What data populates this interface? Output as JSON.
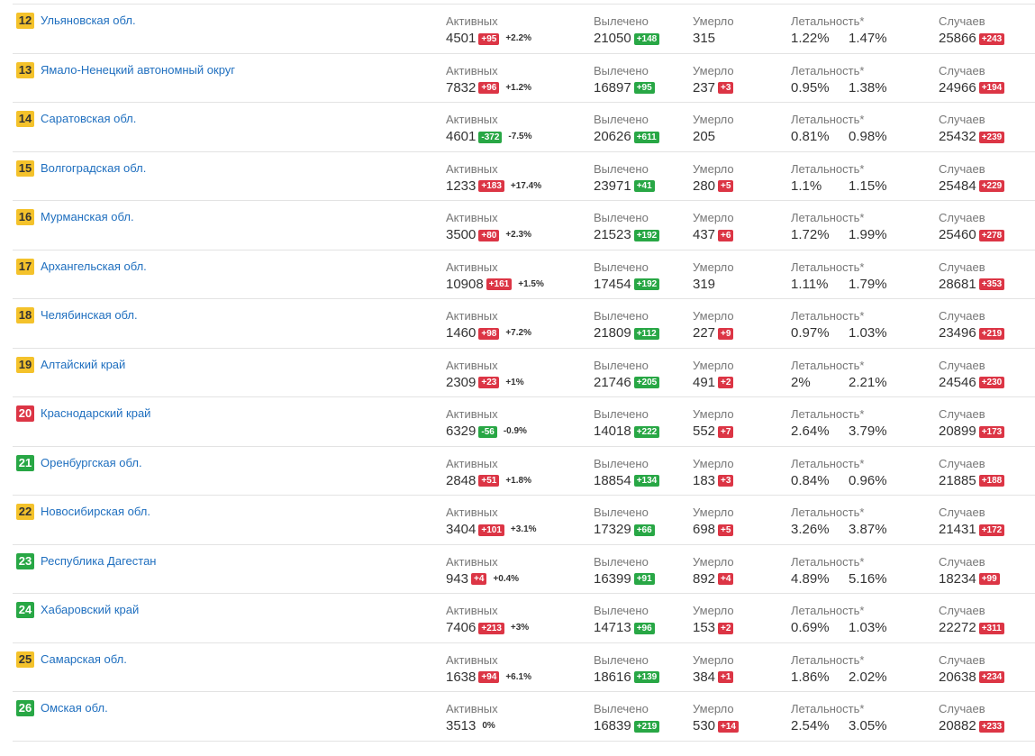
{
  "labels": {
    "active": "Активных",
    "recovered": "Вылечено",
    "died": "Умерло",
    "lethality": "Летальность*",
    "cases": "Случаев"
  },
  "colors": {
    "yellow": "#f4c22b",
    "red": "#dc3545",
    "green": "#28a745",
    "link": "#1f6fbf"
  },
  "rows": [
    {
      "rank": "12",
      "rank_color": "yellow",
      "region": "Ульяновская обл.",
      "active": "4501",
      "active_delta": "+95",
      "active_delta_color": "red",
      "active_pct": "+2.2%",
      "recovered": "21050",
      "recovered_delta": "+148",
      "died": "315",
      "died_delta": "",
      "leth1": "1.22%",
      "leth2": "1.47%",
      "cases": "25866",
      "cases_delta": "+243"
    },
    {
      "rank": "13",
      "rank_color": "yellow",
      "region": "Ямало-Ненецкий автономный округ",
      "active": "7832",
      "active_delta": "+96",
      "active_delta_color": "red",
      "active_pct": "+1.2%",
      "recovered": "16897",
      "recovered_delta": "+95",
      "died": "237",
      "died_delta": "+3",
      "leth1": "0.95%",
      "leth2": "1.38%",
      "cases": "24966",
      "cases_delta": "+194"
    },
    {
      "rank": "14",
      "rank_color": "yellow",
      "region": "Саратовская обл.",
      "active": "4601",
      "active_delta": "-372",
      "active_delta_color": "green",
      "active_pct": "-7.5%",
      "recovered": "20626",
      "recovered_delta": "+611",
      "died": "205",
      "died_delta": "",
      "leth1": "0.81%",
      "leth2": "0.98%",
      "cases": "25432",
      "cases_delta": "+239"
    },
    {
      "rank": "15",
      "rank_color": "yellow",
      "region": "Волгоградская обл.",
      "active": "1233",
      "active_delta": "+183",
      "active_delta_color": "red",
      "active_pct": "+17.4%",
      "recovered": "23971",
      "recovered_delta": "+41",
      "died": "280",
      "died_delta": "+5",
      "leth1": "1.1%",
      "leth2": "1.15%",
      "cases": "25484",
      "cases_delta": "+229"
    },
    {
      "rank": "16",
      "rank_color": "yellow",
      "region": "Мурманская обл.",
      "active": "3500",
      "active_delta": "+80",
      "active_delta_color": "red",
      "active_pct": "+2.3%",
      "recovered": "21523",
      "recovered_delta": "+192",
      "died": "437",
      "died_delta": "+6",
      "leth1": "1.72%",
      "leth2": "1.99%",
      "cases": "25460",
      "cases_delta": "+278"
    },
    {
      "rank": "17",
      "rank_color": "yellow",
      "region": "Архангельская обл.",
      "active": "10908",
      "active_delta": "+161",
      "active_delta_color": "red",
      "active_pct": "+1.5%",
      "recovered": "17454",
      "recovered_delta": "+192",
      "died": "319",
      "died_delta": "",
      "leth1": "1.11%",
      "leth2": "1.79%",
      "cases": "28681",
      "cases_delta": "+353"
    },
    {
      "rank": "18",
      "rank_color": "yellow",
      "region": "Челябинская обл.",
      "active": "1460",
      "active_delta": "+98",
      "active_delta_color": "red",
      "active_pct": "+7.2%",
      "recovered": "21809",
      "recovered_delta": "+112",
      "died": "227",
      "died_delta": "+9",
      "leth1": "0.97%",
      "leth2": "1.03%",
      "cases": "23496",
      "cases_delta": "+219"
    },
    {
      "rank": "19",
      "rank_color": "yellow",
      "region": "Алтайский край",
      "active": "2309",
      "active_delta": "+23",
      "active_delta_color": "red",
      "active_pct": "+1%",
      "recovered": "21746",
      "recovered_delta": "+205",
      "died": "491",
      "died_delta": "+2",
      "leth1": "2%",
      "leth2": "2.21%",
      "cases": "24546",
      "cases_delta": "+230"
    },
    {
      "rank": "20",
      "rank_color": "red",
      "region": "Краснодарский край",
      "active": "6329",
      "active_delta": "-56",
      "active_delta_color": "green",
      "active_pct": "-0.9%",
      "recovered": "14018",
      "recovered_delta": "+222",
      "died": "552",
      "died_delta": "+7",
      "leth1": "2.64%",
      "leth2": "3.79%",
      "cases": "20899",
      "cases_delta": "+173"
    },
    {
      "rank": "21",
      "rank_color": "green",
      "region": "Оренбургская обл.",
      "active": "2848",
      "active_delta": "+51",
      "active_delta_color": "red",
      "active_pct": "+1.8%",
      "recovered": "18854",
      "recovered_delta": "+134",
      "died": "183",
      "died_delta": "+3",
      "leth1": "0.84%",
      "leth2": "0.96%",
      "cases": "21885",
      "cases_delta": "+188"
    },
    {
      "rank": "22",
      "rank_color": "yellow",
      "region": "Новосибирская обл.",
      "active": "3404",
      "active_delta": "+101",
      "active_delta_color": "red",
      "active_pct": "+3.1%",
      "recovered": "17329",
      "recovered_delta": "+66",
      "died": "698",
      "died_delta": "+5",
      "leth1": "3.26%",
      "leth2": "3.87%",
      "cases": "21431",
      "cases_delta": "+172"
    },
    {
      "rank": "23",
      "rank_color": "green",
      "region": "Республика Дагестан",
      "active": "943",
      "active_delta": "+4",
      "active_delta_color": "red",
      "active_pct": "+0.4%",
      "recovered": "16399",
      "recovered_delta": "+91",
      "died": "892",
      "died_delta": "+4",
      "leth1": "4.89%",
      "leth2": "5.16%",
      "cases": "18234",
      "cases_delta": "+99"
    },
    {
      "rank": "24",
      "rank_color": "green",
      "region": "Хабаровский край",
      "active": "7406",
      "active_delta": "+213",
      "active_delta_color": "red",
      "active_pct": "+3%",
      "recovered": "14713",
      "recovered_delta": "+96",
      "died": "153",
      "died_delta": "+2",
      "leth1": "0.69%",
      "leth2": "1.03%",
      "cases": "22272",
      "cases_delta": "+311"
    },
    {
      "rank": "25",
      "rank_color": "yellow",
      "region": "Самарская обл.",
      "active": "1638",
      "active_delta": "+94",
      "active_delta_color": "red",
      "active_pct": "+6.1%",
      "recovered": "18616",
      "recovered_delta": "+139",
      "died": "384",
      "died_delta": "+1",
      "leth1": "1.86%",
      "leth2": "2.02%",
      "cases": "20638",
      "cases_delta": "+234"
    },
    {
      "rank": "26",
      "rank_color": "green",
      "region": "Омская обл.",
      "active": "3513",
      "active_delta": "",
      "active_delta_color": "red",
      "active_pct": "0%",
      "recovered": "16839",
      "recovered_delta": "+219",
      "died": "530",
      "died_delta": "+14",
      "leth1": "2.54%",
      "leth2": "3.05%",
      "cases": "20882",
      "cases_delta": "+233"
    }
  ]
}
